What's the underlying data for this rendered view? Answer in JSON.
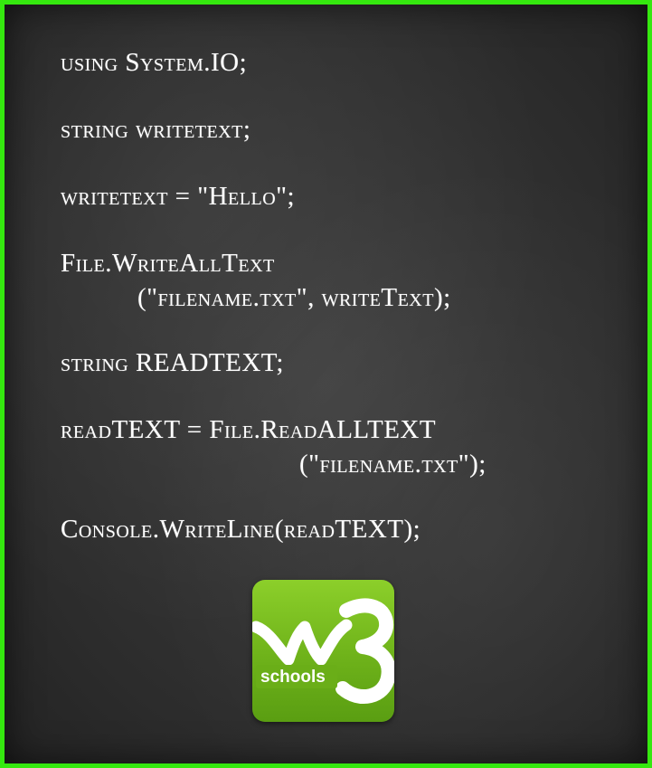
{
  "code": {
    "line1": "using System.IO;",
    "line2": "string writetext;",
    "line3": "writetext = \"Hello\";",
    "line4": "File.WriteAllText",
    "line5": "(\"filename.txt\", writeText);",
    "line6": "string READTEXT;",
    "line7": "readTEXT = File.ReadALLTEXT",
    "line8": "(\"filename.txt\");",
    "line9": "Console.WriteLine(readTEXT);"
  },
  "logo": {
    "label": "schools",
    "icon": "w3-logo",
    "colors": {
      "background": "#7cbf1f",
      "foreground": "#ffffff"
    }
  },
  "colors": {
    "frame": "#35e80f",
    "board": "#2f2f2f",
    "text": "#ffffff"
  }
}
